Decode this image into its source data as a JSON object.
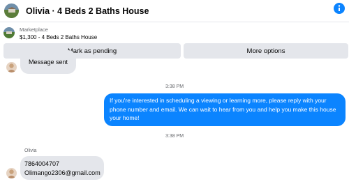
{
  "header": {
    "title": "Olivia · 4 Beds 2 Baths House",
    "info_icon": "info-icon"
  },
  "listing": {
    "source_label": "Marketplace",
    "summary": "$1,300 - 4 Beds 2 Baths House"
  },
  "actions": {
    "mark_pending_label": "Mark as pending",
    "more_options_label": "More options"
  },
  "conversation": {
    "partial_message": "Message sent",
    "timestamp_1": "3:38 PM",
    "outgoing_message": "If you're interested in scheduling a viewing or learning more, please reply with your phone number and email. We can  wait to hear from you and help you make this house your home!",
    "timestamp_2": "3:38 PM",
    "sender_name": "Olivia",
    "reply_phone": "7864004707",
    "reply_email": "Olimango2306@gmail.com"
  },
  "colors": {
    "accent": "#0b84ff",
    "incoming_bubble": "#e4e6eb",
    "button_bg": "#e4e6eb",
    "meta_text": "#65676b"
  }
}
